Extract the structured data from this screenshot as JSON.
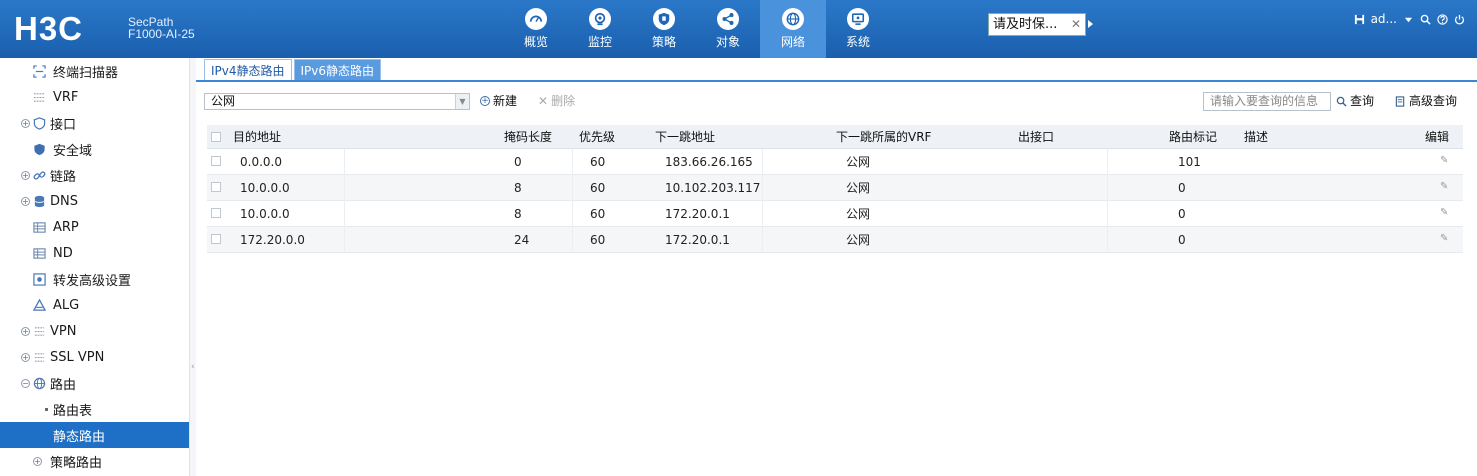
{
  "header": {
    "logo": "H3C",
    "device_line1": "SecPath",
    "device_line2": "F1000-AI-25",
    "nav": [
      {
        "label": "概览",
        "icon": "gauge-icon"
      },
      {
        "label": "监控",
        "icon": "camera-icon"
      },
      {
        "label": "策略",
        "icon": "shield-icon"
      },
      {
        "label": "对象",
        "icon": "share-icon"
      },
      {
        "label": "网络",
        "icon": "globe-icon",
        "active": true
      },
      {
        "label": "系统",
        "icon": "monitor-icon"
      }
    ],
    "select_value": "请及时保...",
    "user": "ad..."
  },
  "sidebar": {
    "items": [
      {
        "label": "终端扫描器"
      },
      {
        "label": "VRF"
      },
      {
        "label": "接口"
      },
      {
        "label": "安全域"
      },
      {
        "label": "链路"
      },
      {
        "label": "DNS"
      },
      {
        "label": "ARP"
      },
      {
        "label": "ND"
      },
      {
        "label": "转发高级设置"
      },
      {
        "label": "ALG"
      },
      {
        "label": "VPN"
      },
      {
        "label": "SSL VPN"
      },
      {
        "label": "路由"
      },
      {
        "label": "路由表"
      },
      {
        "label": "静态路由"
      },
      {
        "label": "策略路由"
      }
    ]
  },
  "tabs": [
    "IPv4静态路由",
    "IPv6静态路由"
  ],
  "toolbar": {
    "vrf_value": "公网",
    "new_label": "新建",
    "delete_label": "删除",
    "search_placeholder": "请输入要查询的信息",
    "query_label": "查询",
    "advanced_label": "高级查询"
  },
  "table": {
    "headers": {
      "dest": "目的地址",
      "mask": "掩码长度",
      "priority": "优先级",
      "nexthop": "下一跳地址",
      "nexthop_vrf": "下一跳所属的VRF",
      "out_if": "出接口",
      "tag": "路由标记",
      "desc": "描述",
      "edit": "编辑"
    },
    "rows": [
      {
        "dest": "0.0.0.0",
        "mask": "0",
        "priority": "60",
        "nexthop": "183.66.26.165",
        "nexthop_vrf": "公网",
        "out_if": "",
        "tag": "101",
        "desc": ""
      },
      {
        "dest": "10.0.0.0",
        "mask": "8",
        "priority": "60",
        "nexthop": "10.102.203.117",
        "nexthop_vrf": "公网",
        "out_if": "",
        "tag": "0",
        "desc": ""
      },
      {
        "dest": "10.0.0.0",
        "mask": "8",
        "priority": "60",
        "nexthop": "172.20.0.1",
        "nexthop_vrf": "公网",
        "out_if": "",
        "tag": "0",
        "desc": ""
      },
      {
        "dest": "172.20.0.0",
        "mask": "24",
        "priority": "60",
        "nexthop": "172.20.0.1",
        "nexthop_vrf": "公网",
        "out_if": "",
        "tag": "0",
        "desc": ""
      }
    ]
  }
}
